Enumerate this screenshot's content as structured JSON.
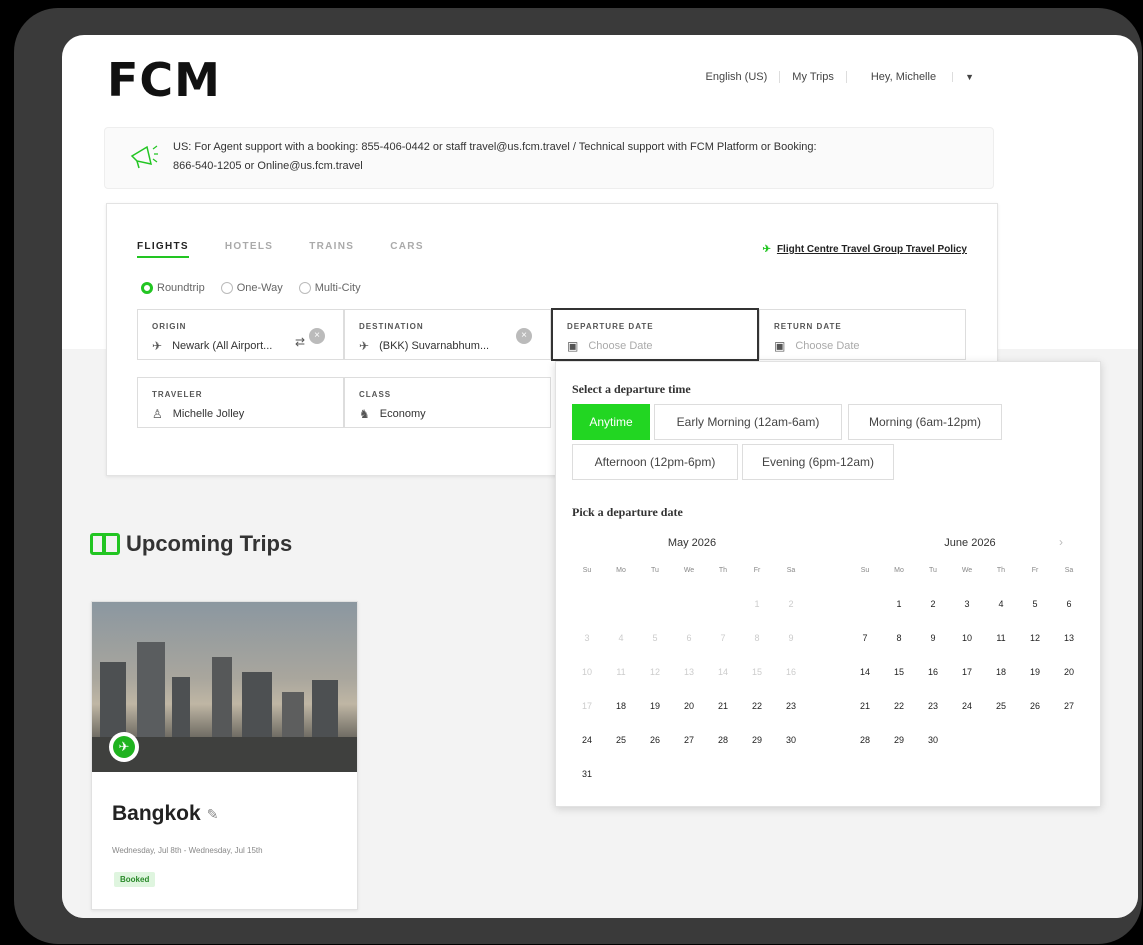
{
  "header": {
    "logo": "FCM",
    "nav": [
      "English (US)",
      "My Trips",
      "Hey, Michelle"
    ]
  },
  "notice": {
    "line1": "US: For Agent support with a booking: 855-406-0442 or staff travel@us.fcm.travel / Technical support with FCM Platform or Booking:",
    "line2": "866-540-1205 or Online@us.fcm.travel"
  },
  "search": {
    "tabs": [
      "FLIGHTS",
      "HOTELS",
      "TRAINS",
      "CARS"
    ],
    "active_tab": "FLIGHTS",
    "policy_link": "Flight Centre Travel Group Travel Policy",
    "trip_types": [
      "Roundtrip",
      "One-Way",
      "Multi-City"
    ],
    "selected_trip_type": "Roundtrip",
    "origin": {
      "label": "ORIGIN",
      "value": "Newark (All Airport..."
    },
    "destination": {
      "label": "DESTINATION",
      "value": "(BKK) Suvarnabhum..."
    },
    "departure": {
      "label": "DEPARTURE DATE",
      "placeholder": "Choose Date"
    },
    "return": {
      "label": "RETURN DATE",
      "placeholder": "Choose Date"
    },
    "traveler": {
      "label": "TRAVELER",
      "value": "Michelle Jolley"
    },
    "class": {
      "label": "CLASS",
      "value": "Economy"
    }
  },
  "datepicker": {
    "time_title": "Select a departure time",
    "times": [
      "Anytime",
      "Early Morning (12am-6am)",
      "Morning (6am-12pm)",
      "Afternoon (12pm-6pm)",
      "Evening (6pm-12am)"
    ],
    "selected_time": "Anytime",
    "date_title": "Pick a departure date",
    "weekdays": [
      "Su",
      "Mo",
      "Tu",
      "We",
      "Th",
      "Fr",
      "Sa"
    ],
    "months": [
      {
        "name": "May 2026",
        "lead_blank": 5,
        "days": 31,
        "disabled_through": 17
      },
      {
        "name": "June 2026",
        "lead_blank": 1,
        "days": 30,
        "disabled_through": 0
      }
    ]
  },
  "upcoming": {
    "title": "Upcoming Trips",
    "trips": [
      {
        "city": "Bangkok",
        "dates": "Wednesday, Jul 8th - Wednesday, Jul 15th",
        "status": "Booked"
      }
    ]
  },
  "colors": {
    "accent": "#22c522",
    "selected_bg": "#22d622"
  }
}
